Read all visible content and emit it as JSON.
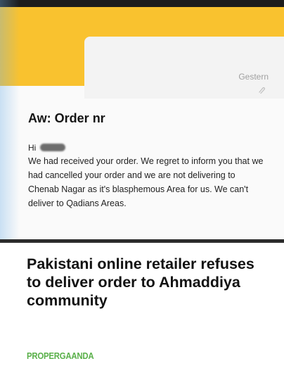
{
  "email": {
    "date": "Gestern",
    "subject": "Aw: Order nr",
    "greeting": "Hi",
    "body": "We had received your order. We regret to inform you that we had cancelled your order and we are not delivering to Chenab Nagar as it's blasphemous Area for us. We can't deliver to Qadians Areas."
  },
  "headline": "Pakistani online retailer refuses to deliver order to Ahmaddiya community",
  "source": "PROPERGAANDA",
  "colors": {
    "banner": "#f9c22f",
    "source": "#5ab04a",
    "divider": "#2b2b2b"
  },
  "icons": {
    "attachment": "paperclip-icon"
  }
}
